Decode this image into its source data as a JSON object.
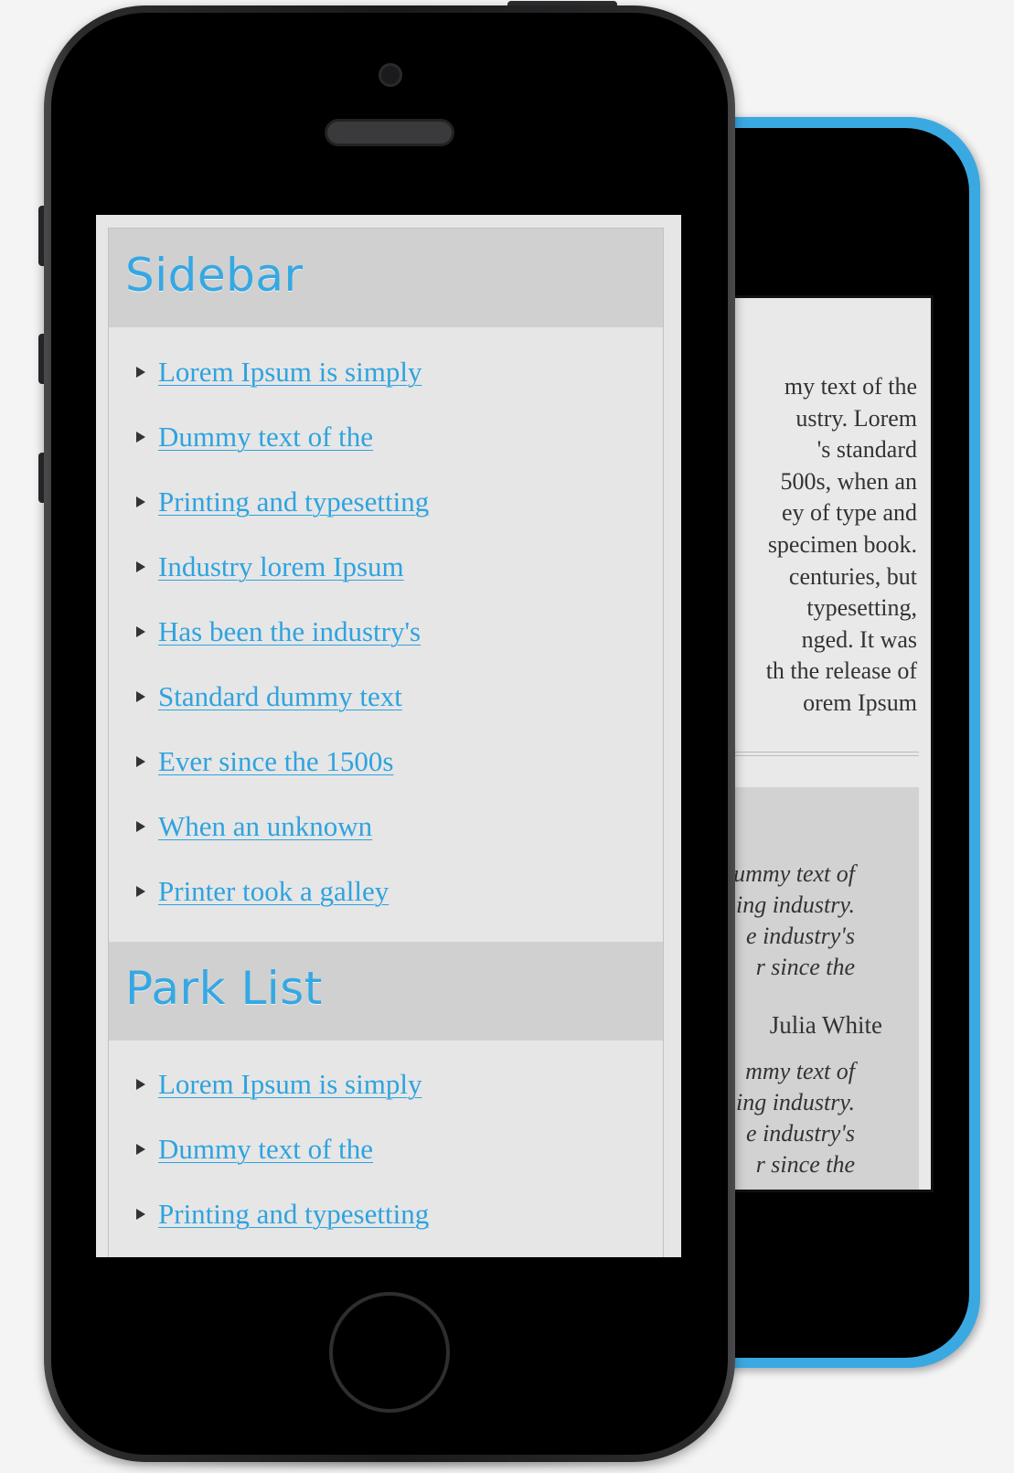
{
  "sidebar": {
    "title": "Sidebar",
    "links": [
      "Lorem Ipsum is simply",
      "Dummy text of the",
      "Printing and typesetting",
      "Industry lorem Ipsum",
      "Has been the industry's",
      "Standard dummy text",
      "Ever since the 1500s",
      "When an unknown",
      "Printer took a galley"
    ]
  },
  "park_list": {
    "title": "Park List",
    "links": [
      "Lorem Ipsum is simply",
      "Dummy text of the",
      "Printing and typesetting"
    ]
  },
  "back_screen": {
    "paragraph_lines": [
      "my text of the",
      "ustry. Lorem",
      "'s standard",
      "500s, when an",
      "ey of type and",
      "specimen book.",
      "centuries, but",
      "typesetting,",
      "nged. It was",
      "th the release of",
      "orem Ipsum"
    ],
    "quote1_lines": [
      "ummy text of",
      "ing industry.",
      "e industry's",
      "r since the"
    ],
    "author": "Julia White",
    "quote2_lines": [
      "mmy text of",
      "ing industry.",
      "e industry's",
      "r since the"
    ]
  },
  "colors": {
    "accent": "#35a8e3",
    "back_phone": "#3aa9e2",
    "front_phone": "#1a1a1b"
  }
}
